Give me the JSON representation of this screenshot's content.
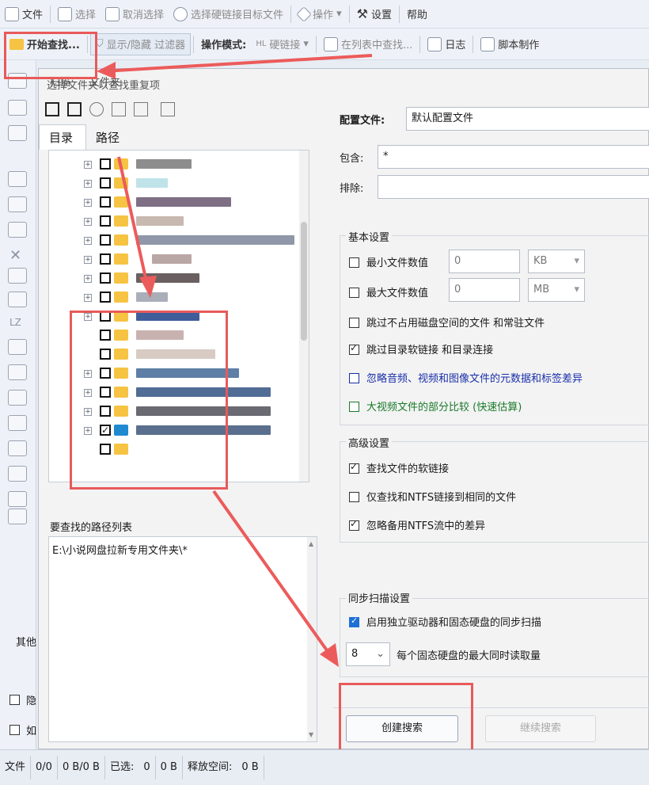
{
  "toolbar1": {
    "file": "文件",
    "select": "选择",
    "deselect": "取消选择",
    "select_hardlink_target": "选择硬链接目标文件",
    "actions": "操作",
    "settings": "设置",
    "help": "帮助"
  },
  "toolbar2": {
    "start_search": "开始查找...",
    "toggle_filter": "显示/隐藏 过滤器",
    "mode_label": "操作模式:",
    "mode_value": "硬链接",
    "find_in_list": "在列表中查找...",
    "log": "日志",
    "script": "脚本制作"
  },
  "left": {
    "lz": "LZ"
  },
  "dialog": {
    "tabs": [
      "扫描",
      "文件夹"
    ],
    "subtitle": "选择文件夹以查找重复项",
    "subtabs": [
      "目录",
      "路径"
    ],
    "path_list_label": "要查找的路径列表",
    "path_entry": "E:\\小说网盘拉新专用文件夹\\*",
    "config_label": "配置文件:",
    "config_value": "默认配置文件",
    "include_label": "包含:",
    "include_value": "*",
    "exclude_label": "排除:",
    "basic": {
      "title": "基本设置",
      "min_file": "最小文件数值",
      "min_value": "0",
      "min_unit": "KB",
      "max_file": "最大文件数值",
      "max_value": "0",
      "max_unit": "MB",
      "skip_sparse": "跳过不占用磁盘空间的文件 和常驻文件",
      "skip_dir_links": "跳过目录软链接 和目录连接",
      "ignore_metadata": "忽略音频、视频和图像文件的元数据和标签差异",
      "partial_compare": "大视频文件的部分比较 (快速估算)"
    },
    "advanced": {
      "title": "高级设置",
      "find_soft_links": "查找文件的软链接",
      "ntfs_same": "仅查找和NTFS链接到相同的文件",
      "ignore_streams": "忽略备用NTFS流中的差异"
    },
    "sync": {
      "title": "同步扫描设置",
      "enable_sync": "启用独立驱动器和固态硬盘的同步扫描",
      "threads_value": "8",
      "threads_label": "每个固态硬盘的最大同时读取量"
    },
    "create_search": "创建搜索",
    "continue_search": "继续搜索"
  },
  "outside": {
    "other": "其他",
    "hide": "隐",
    "as": "如"
  },
  "status": {
    "file": "文件",
    "count": "0/0",
    "size": "0 B/0 B",
    "selected_label": "已选:",
    "selected": "0",
    "selected_size": "0 B",
    "free_label": "释放空间:",
    "free": "0 B"
  },
  "colors": {
    "annotation": "#e85a5a",
    "folder": "#f6c343",
    "accent_blue": "#1e6fd6",
    "ignore_text": "#1a2faa",
    "partial_text": "#1a7a2a"
  }
}
